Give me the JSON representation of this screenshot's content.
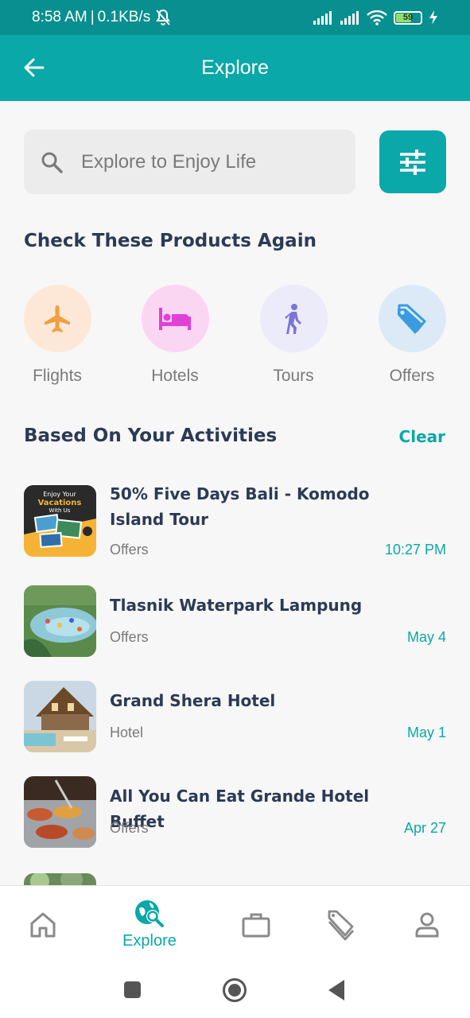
{
  "status_bar": {
    "time": "8:58 AM",
    "speed": "0.1KB/s",
    "battery": "59",
    "icons": [
      "mute-icon",
      "signal-icon",
      "signal-icon",
      "wifi-icon",
      "battery-icon",
      "charging-icon"
    ]
  },
  "app_bar": {
    "title": "Explore",
    "back_icon": "arrow-left-icon"
  },
  "search": {
    "placeholder": "Explore to Enjoy Life",
    "icon": "search-icon",
    "filter_icon": "sliders-icon"
  },
  "products": {
    "title": "Check These Products Again",
    "items": [
      {
        "label": "Flights",
        "icon": "airplane-icon",
        "bg": "#fde8d8",
        "color": "#f0a040"
      },
      {
        "label": "Hotels",
        "icon": "bed-icon",
        "bg": "#fbd6f3",
        "color": "#e040d8"
      },
      {
        "label": "Tours",
        "icon": "walking-person-icon",
        "bg": "#ecebfa",
        "color": "#7d74d6"
      },
      {
        "label": "Offers",
        "icon": "tag-icon",
        "bg": "#dceaf7",
        "color": "#3a9be0"
      }
    ]
  },
  "activities": {
    "title": "Based On Your Activities",
    "clear_label": "Clear",
    "items": [
      {
        "title": "50% Five Days Bali - Komodo Island Tour",
        "category": "Offers",
        "time": "10:27 PM",
        "thumb_text": [
          "Enjoy Your",
          "Vacations",
          "With Us"
        ]
      },
      {
        "title": "Tlasnik Waterpark Lampung",
        "category": "Offers",
        "time": "May 4"
      },
      {
        "title": "Grand Shera Hotel",
        "category": "Hotel",
        "time": "May 1"
      },
      {
        "title": "All You Can Eat Grande Hotel Buffet",
        "category": "Offers",
        "time": "Apr 27"
      }
    ]
  },
  "bottom_nav": {
    "items": [
      {
        "icon": "home-icon",
        "label": ""
      },
      {
        "icon": "explore-icon",
        "label": "Explore",
        "active": true
      },
      {
        "icon": "briefcase-icon",
        "label": ""
      },
      {
        "icon": "tags-icon",
        "label": ""
      },
      {
        "icon": "profile-icon",
        "label": ""
      }
    ]
  },
  "colors": {
    "primary": "#0aa8a8",
    "status_bar": "#088f8f",
    "text_dark": "#2b3a55",
    "text_muted": "#7a7a7a"
  }
}
